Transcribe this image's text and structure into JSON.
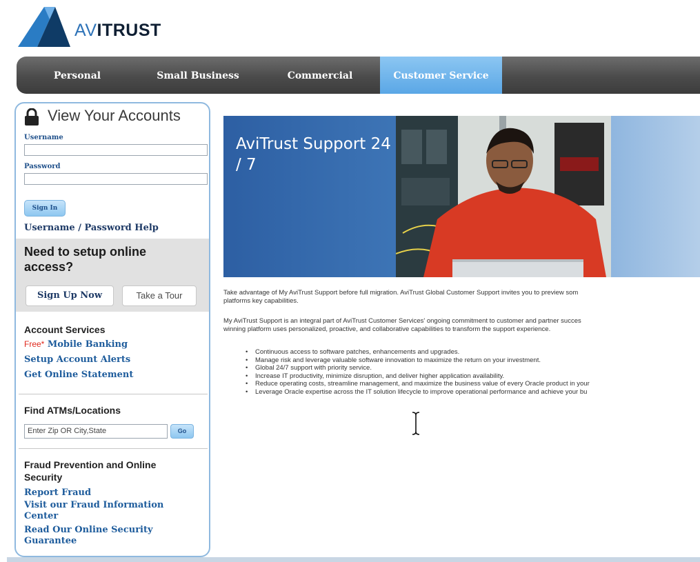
{
  "brand": {
    "name_prefix": "AV",
    "name_suffix": "ITRUST",
    "logo_icon": "avitrust-logo-icon"
  },
  "nav": {
    "items": [
      {
        "label": "Personal",
        "active": false
      },
      {
        "label": "Small Business",
        "active": false
      },
      {
        "label": "Commercial",
        "active": false
      },
      {
        "label": "Customer Service",
        "active": true
      }
    ]
  },
  "login": {
    "title": "View Your Accounts",
    "icon": "lock-icon",
    "username_label": "Username",
    "username_value": "",
    "password_label": "Password",
    "password_value": "",
    "sign_in_label": "Sign In",
    "help_link": "Username / Password Help"
  },
  "setup": {
    "title": "Need to setup online access?",
    "sign_up_label": "Sign Up Now",
    "tour_label": "Take a Tour"
  },
  "account_services": {
    "title": "Account Services",
    "free_tag": "Free*",
    "links": [
      "Mobile Banking",
      "Setup Account Alerts",
      "Get Online Statement"
    ]
  },
  "atm": {
    "title": "Find ATMs/Locations",
    "input_value": "Enter Zip OR City,State",
    "go_label": "Go"
  },
  "fraud": {
    "title": "Fraud Prevention and Online Security",
    "links": [
      "Report Fraud",
      "Visit our Fraud Information Center",
      "Read Our Online Security Guarantee"
    ]
  },
  "banner": {
    "title": "AviTrust Support 24 / 7"
  },
  "content": {
    "para1": [
      "Take advantage of My AviTrust Support before full migration. AviTrust Global Customer Support invites you to preview som",
      "platforms key capabilities."
    ],
    "para2": [
      "My AviTrust Support is an integral part of AviTrust Customer Services' ongoing commitment to customer and partner succes",
      "winning platform uses personalized, proactive, and collaborative capabilities to transform the support experience."
    ],
    "bullets": [
      "Continuous access to software patches, enhancements and upgrades.",
      "Manage risk and leverage valuable software innovation to maximize the return on your investment.",
      "Global 24/7 support with priority service.",
      "Increase IT productivity, minimize disruption, and deliver higher application availability.",
      "Reduce operating costs, streamline management, and maximize the business value of every Oracle product in your",
      "Leverage Oracle expertise across the IT solution lifecycle to improve operational performance and achieve your bu"
    ]
  },
  "colors": {
    "nav_active": "#6fb5ec",
    "link": "#1e5c9c",
    "accent": "#2e73b8"
  }
}
